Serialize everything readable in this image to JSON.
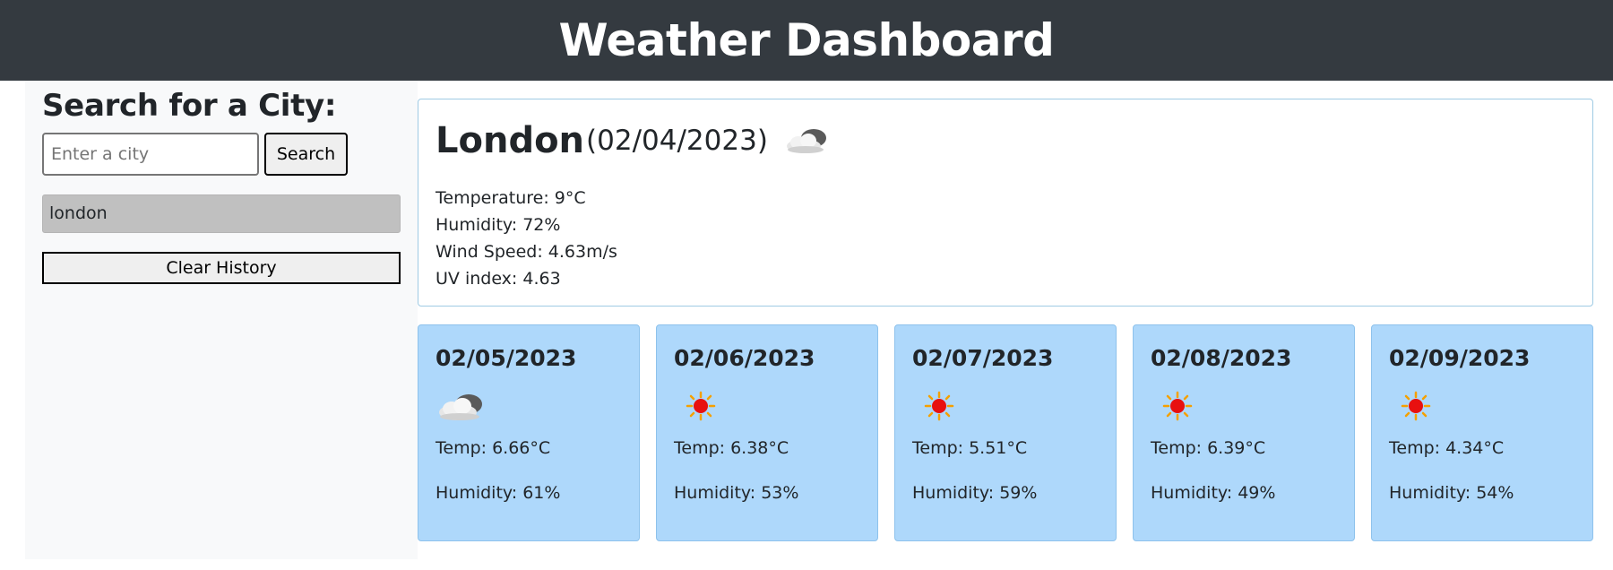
{
  "header": {
    "title": "Weather Dashboard"
  },
  "search": {
    "heading": "Search for a City:",
    "placeholder": "Enter a city",
    "value": "",
    "button_label": "Search",
    "clear_label": "Clear History"
  },
  "history": [
    "london"
  ],
  "current": {
    "city": "London",
    "date": "(02/04/2023)",
    "icon": "cloudy-icon",
    "temperature": "Temperature: 9°C",
    "humidity": "Humidity: 72%",
    "wind": "Wind Speed: 4.63m/s",
    "uv": "UV index: 4.63"
  },
  "forecast": [
    {
      "date": "02/05/2023",
      "icon": "cloudy-icon",
      "temp": "Temp: 6.66°C",
      "humidity": "Humidity: 61%"
    },
    {
      "date": "02/06/2023",
      "icon": "sunny-icon",
      "temp": "Temp: 6.38°C",
      "humidity": "Humidity: 53%"
    },
    {
      "date": "02/07/2023",
      "icon": "sunny-icon",
      "temp": "Temp: 5.51°C",
      "humidity": "Humidity: 59%"
    },
    {
      "date": "02/08/2023",
      "icon": "sunny-icon",
      "temp": "Temp: 6.39°C",
      "humidity": "Humidity: 49%"
    },
    {
      "date": "02/09/2023",
      "icon": "sunny-icon",
      "temp": "Temp: 4.34°C",
      "humidity": "Humidity: 54%"
    }
  ],
  "colors": {
    "header_bg": "#343a40",
    "sidebar_bg": "#f8f9fa",
    "forecast_bg": "#aed8fb",
    "history_bg": "#c0c0c0"
  }
}
